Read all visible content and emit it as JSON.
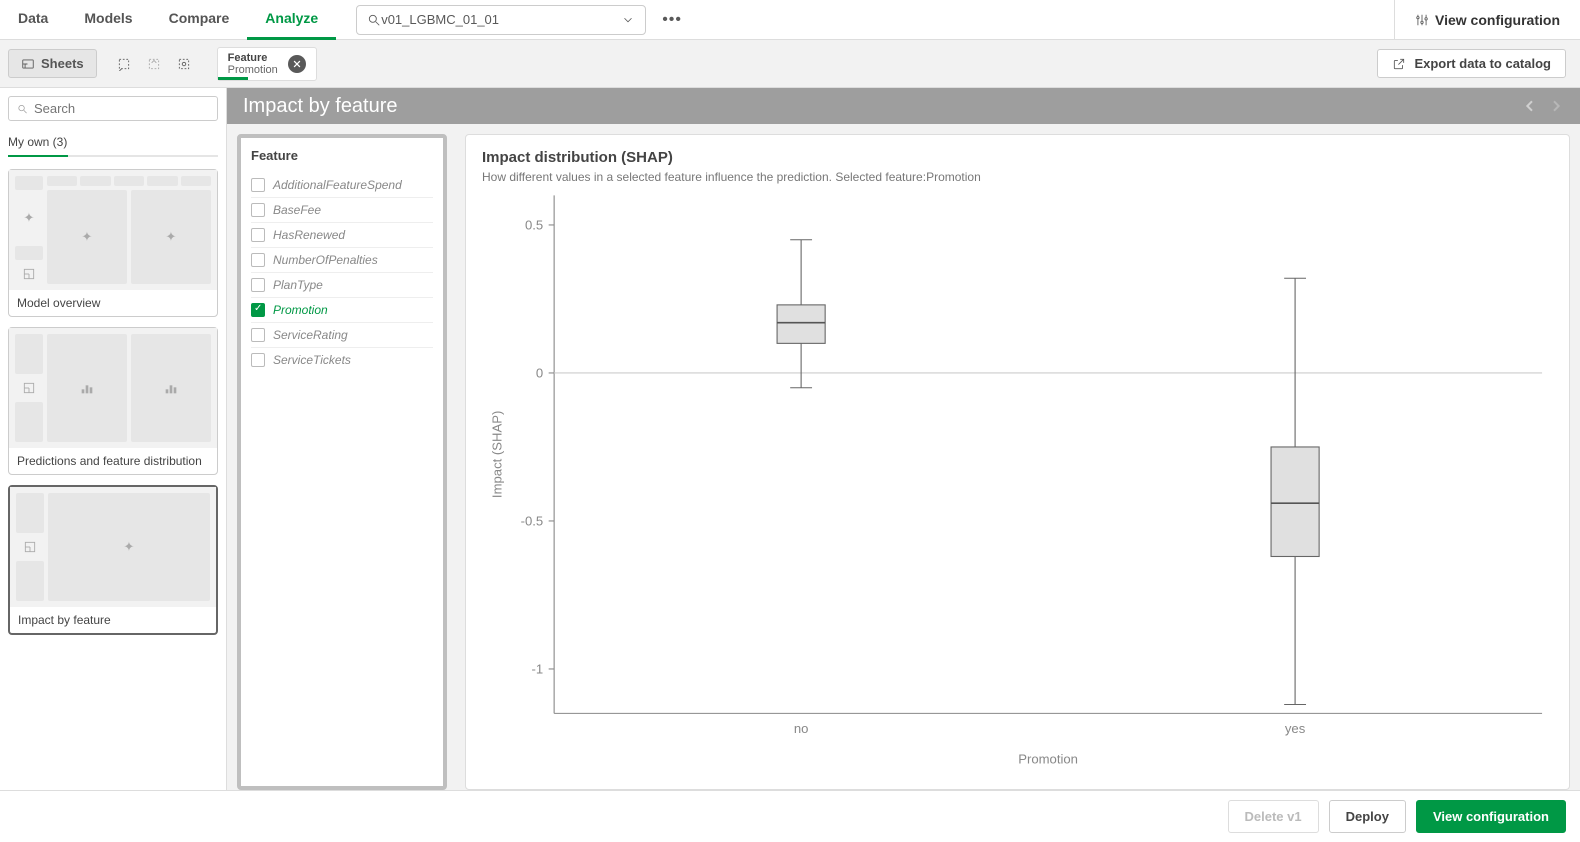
{
  "nav": {
    "tabs": [
      "Data",
      "Models",
      "Compare",
      "Analyze"
    ],
    "active": 3,
    "model_selector": "v01_LGBMC_01_01",
    "view_config": "View configuration"
  },
  "secondbar": {
    "sheets_btn": "Sheets",
    "feature_tab_label": "Feature",
    "feature_tab_value": "Promotion",
    "export_btn": "Export data to catalog"
  },
  "sidebar": {
    "search_placeholder": "Search",
    "group_label": "My own (3)",
    "sheets": [
      {
        "label": "Model overview"
      },
      {
        "label": "Predictions and feature distribution"
      },
      {
        "label": "Impact by feature"
      }
    ],
    "active_sheet": 2
  },
  "content": {
    "header": "Impact by feature",
    "feature_panel_title": "Feature",
    "features": [
      {
        "name": "AdditionalFeatureSpend",
        "selected": false
      },
      {
        "name": "BaseFee",
        "selected": false
      },
      {
        "name": "HasRenewed",
        "selected": false
      },
      {
        "name": "NumberOfPenalties",
        "selected": false
      },
      {
        "name": "PlanType",
        "selected": false
      },
      {
        "name": "Promotion",
        "selected": true
      },
      {
        "name": "ServiceRating",
        "selected": false
      },
      {
        "name": "ServiceTickets",
        "selected": false
      }
    ],
    "chart": {
      "title": "Impact distribution (SHAP)",
      "desc_prefix": "How different values in a selected feature influence the prediction. Selected feature:",
      "selected_feature": "Promotion"
    }
  },
  "footer": {
    "delete": "Delete v1",
    "deploy": "Deploy",
    "view_config": "View configuration"
  },
  "chart_data": {
    "type": "boxplot",
    "title": "Impact distribution (SHAP)",
    "xlabel": "Promotion",
    "ylabel": "Impact (SHAP)",
    "ylim": [
      -1.15,
      0.6
    ],
    "yticks": [
      -1,
      -0.5,
      0,
      0.5
    ],
    "categories": [
      "no",
      "yes"
    ],
    "series": [
      {
        "category": "no",
        "whisker_low": -0.05,
        "q1": 0.1,
        "median": 0.17,
        "q3": 0.23,
        "whisker_high": 0.45
      },
      {
        "category": "yes",
        "whisker_low": -1.12,
        "q1": -0.62,
        "median": -0.44,
        "q3": -0.25,
        "whisker_high": 0.32
      }
    ]
  }
}
